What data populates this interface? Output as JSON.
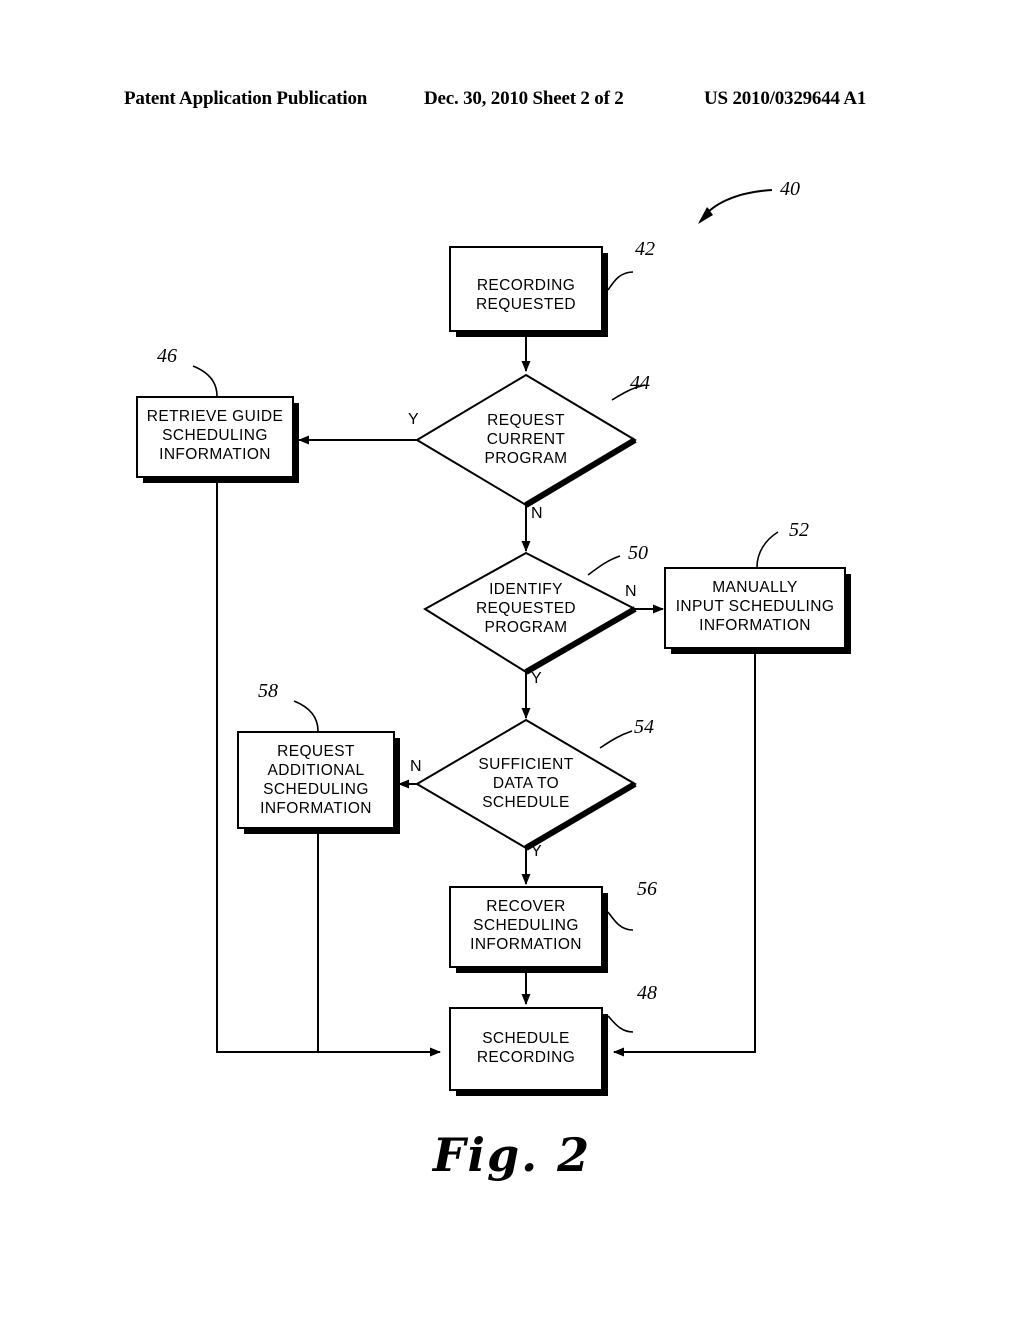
{
  "header": {
    "publication": "Patent Application Publication",
    "date_sheet": "Dec. 30, 2010  Sheet 2 of 2",
    "patent_number": "US 2010/0329644 A1"
  },
  "figure": {
    "caption": "Fig. 2",
    "diagram_ref": "40"
  },
  "nodes": [
    {
      "id": "n42",
      "ref": "42",
      "shape": "process",
      "text": "RECORDING\nREQUESTED"
    },
    {
      "id": "n44",
      "ref": "44",
      "shape": "decision",
      "text": "REQUEST\nCURRENT\nPROGRAM"
    },
    {
      "id": "n46",
      "ref": "46",
      "shape": "process",
      "text": "RETRIEVE GUIDE\nSCHEDULING\nINFORMATION"
    },
    {
      "id": "n50",
      "ref": "50",
      "shape": "decision",
      "text": "IDENTIFY\nREQUESTED\nPROGRAM"
    },
    {
      "id": "n52",
      "ref": "52",
      "shape": "process",
      "text": "MANUALLY\nINPUT SCHEDULING\nINFORMATION"
    },
    {
      "id": "n54",
      "ref": "54",
      "shape": "decision",
      "text": "SUFFICIENT\nDATA TO\nSCHEDULE"
    },
    {
      "id": "n56",
      "ref": "56",
      "shape": "process",
      "text": "RECOVER\nSCHEDULING\nINFORMATION"
    },
    {
      "id": "n58",
      "ref": "58",
      "shape": "process",
      "text": "REQUEST\nADDITIONAL\nSCHEDULING\nINFORMATION"
    },
    {
      "id": "n48",
      "ref": "48",
      "shape": "process",
      "text": "SCHEDULE\nRECORDING"
    }
  ],
  "branches": {
    "d44_yes": "Y",
    "d44_no": "N",
    "d50_no": "N",
    "d50_yes": "Y",
    "d54_no": "N",
    "d54_yes": "Y"
  },
  "colors": {
    "ink": "#000000",
    "paper": "#ffffff"
  }
}
